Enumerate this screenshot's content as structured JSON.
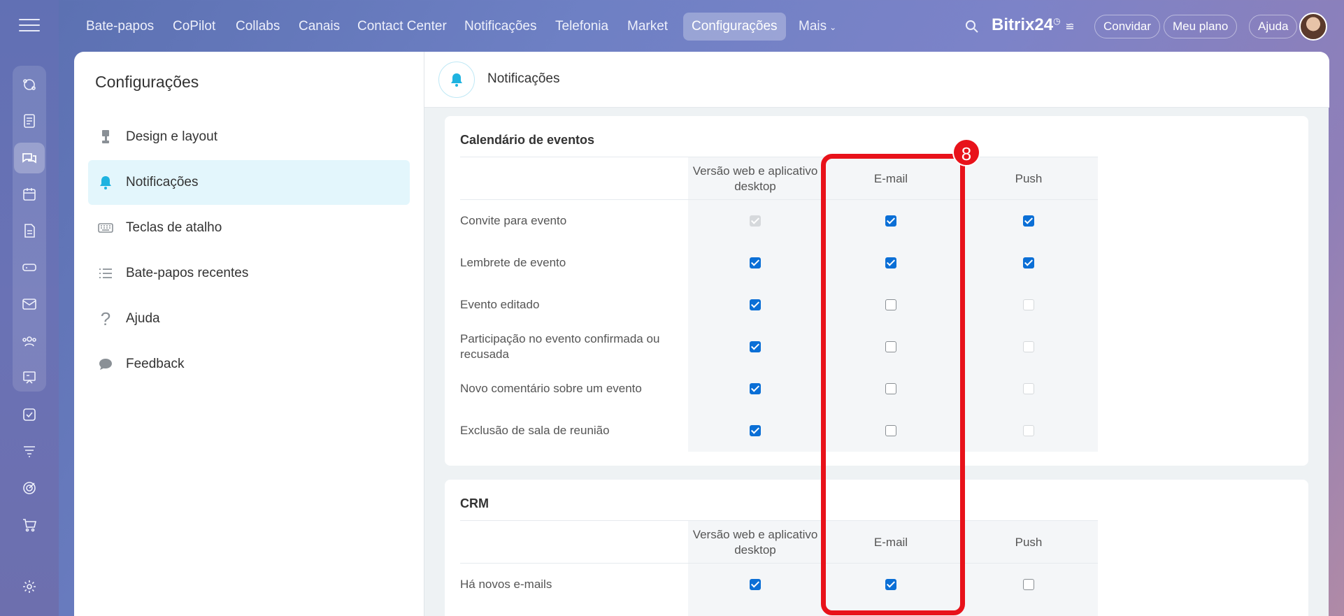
{
  "topnav": {
    "items": [
      "Bate-papos",
      "CoPilot",
      "Collabs",
      "Canais",
      "Contact Center",
      "Notificações",
      "Telefonia",
      "Market",
      "Configurações",
      "Mais"
    ],
    "active": "Configurações",
    "logo": "Bitrix",
    "logo_num": "24",
    "invite": "Convidar",
    "plan": "Meu plano",
    "help": "Ajuda"
  },
  "settings": {
    "title": "Configurações",
    "menu": [
      {
        "label": "Design e layout",
        "icon": "brush-icon"
      },
      {
        "label": "Notificações",
        "icon": "bell-icon"
      },
      {
        "label": "Teclas de atalho",
        "icon": "keyboard-icon"
      },
      {
        "label": "Bate-papos recentes",
        "icon": "list-icon"
      },
      {
        "label": "Ajuda",
        "icon": "question-icon"
      },
      {
        "label": "Feedback",
        "icon": "chat-bubble-icon"
      }
    ]
  },
  "content": {
    "title": "Notificações",
    "columns": [
      "Versão web e aplicativo desktop",
      "E-mail",
      "Push"
    ],
    "calendar": {
      "title": "Calendário de eventos",
      "rows": [
        {
          "label": "Convite para evento",
          "web": "checked-disabled",
          "email": "checked",
          "push": "checked"
        },
        {
          "label": "Lembrete de evento",
          "web": "checked",
          "email": "checked",
          "push": "checked"
        },
        {
          "label": "Evento editado",
          "web": "checked",
          "email": "unchecked",
          "push": "disabled"
        },
        {
          "label": "Participação no evento confirmada ou recusada",
          "web": "checked",
          "email": "unchecked",
          "push": "disabled"
        },
        {
          "label": "Novo comentário sobre um evento",
          "web": "checked",
          "email": "unchecked",
          "push": "disabled"
        },
        {
          "label": "Exclusão de sala de reunião",
          "web": "checked",
          "email": "unchecked",
          "push": "disabled"
        }
      ]
    },
    "crm": {
      "title": "CRM",
      "rows": [
        {
          "label": "Há novos e-mails",
          "web": "checked",
          "email": "checked",
          "push": "unchecked"
        }
      ]
    }
  },
  "annotation": {
    "badge": "8",
    "color": "#e8121a"
  },
  "colors": {
    "accent": "#0b6fd6",
    "active_menu_bg": "#e3f6fc"
  }
}
